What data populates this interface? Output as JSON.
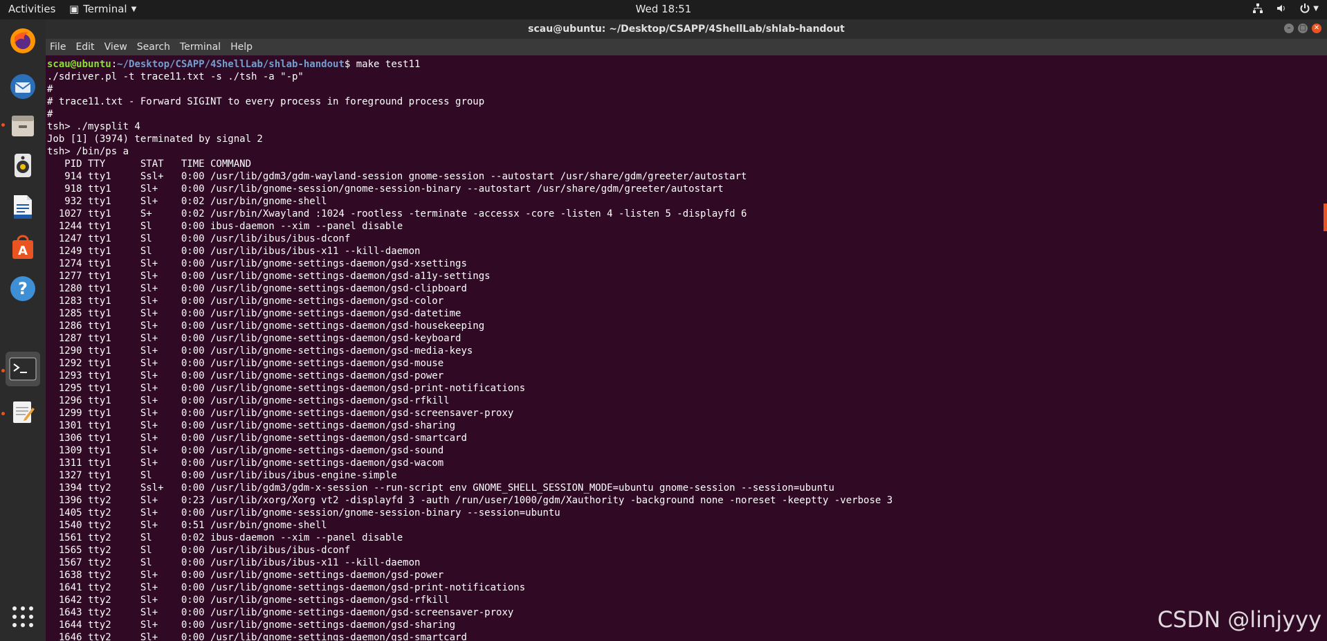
{
  "topbar": {
    "activities": "Activities",
    "app_name": "Terminal",
    "clock": "Wed 18:51",
    "tray_icons": [
      "network-icon",
      "volume-icon",
      "power-icon"
    ]
  },
  "dock": {
    "items": [
      {
        "name": "firefox-icon",
        "glyph": "🦊"
      },
      {
        "name": "thunderbird-icon",
        "glyph": "✉"
      },
      {
        "name": "files-icon",
        "glyph": "🗄"
      },
      {
        "name": "rhythmbox-icon",
        "glyph": "🔊"
      },
      {
        "name": "writer-icon",
        "glyph": "📄"
      },
      {
        "name": "software-icon",
        "glyph": "A"
      },
      {
        "name": "help-icon",
        "glyph": "?"
      },
      {
        "name": "terminal-icon",
        "glyph": ">_"
      },
      {
        "name": "text-editor-icon",
        "glyph": "✎"
      }
    ],
    "apps_grid": "show-applications-icon"
  },
  "window": {
    "title": "scau@ubuntu: ~/Desktop/CSAPP/4ShellLab/shlab-handout",
    "menu": [
      "File",
      "Edit",
      "View",
      "Search",
      "Terminal",
      "Help"
    ]
  },
  "terminal": {
    "prompt_user": "scau@ubuntu",
    "prompt_path": "~/Desktop/CSAPP/4ShellLab/shlab-handout",
    "command": "make test11",
    "lines": [
      "./sdriver.pl -t trace11.txt -s ./tsh -a \"-p\"",
      "#",
      "# trace11.txt - Forward SIGINT to every process in foreground process group",
      "#",
      "tsh> ./mysplit 4",
      "Job [1] (3974) terminated by signal 2",
      "tsh> /bin/ps a",
      "   PID TTY      STAT   TIME COMMAND",
      "   914 tty1     Ssl+   0:00 /usr/lib/gdm3/gdm-wayland-session gnome-session --autostart /usr/share/gdm/greeter/autostart",
      "   918 tty1     Sl+    0:00 /usr/lib/gnome-session/gnome-session-binary --autostart /usr/share/gdm/greeter/autostart",
      "   932 tty1     Sl+    0:02 /usr/bin/gnome-shell",
      "  1027 tty1     S+     0:02 /usr/bin/Xwayland :1024 -rootless -terminate -accessx -core -listen 4 -listen 5 -displayfd 6",
      "  1244 tty1     Sl     0:00 ibus-daemon --xim --panel disable",
      "  1247 tty1     Sl     0:00 /usr/lib/ibus/ibus-dconf",
      "  1249 tty1     Sl     0:00 /usr/lib/ibus/ibus-x11 --kill-daemon",
      "  1274 tty1     Sl+    0:00 /usr/lib/gnome-settings-daemon/gsd-xsettings",
      "  1277 tty1     Sl+    0:00 /usr/lib/gnome-settings-daemon/gsd-a11y-settings",
      "  1280 tty1     Sl+    0:00 /usr/lib/gnome-settings-daemon/gsd-clipboard",
      "  1283 tty1     Sl+    0:00 /usr/lib/gnome-settings-daemon/gsd-color",
      "  1285 tty1     Sl+    0:00 /usr/lib/gnome-settings-daemon/gsd-datetime",
      "  1286 tty1     Sl+    0:00 /usr/lib/gnome-settings-daemon/gsd-housekeeping",
      "  1287 tty1     Sl+    0:00 /usr/lib/gnome-settings-daemon/gsd-keyboard",
      "  1290 tty1     Sl+    0:00 /usr/lib/gnome-settings-daemon/gsd-media-keys",
      "  1292 tty1     Sl+    0:00 /usr/lib/gnome-settings-daemon/gsd-mouse",
      "  1293 tty1     Sl+    0:00 /usr/lib/gnome-settings-daemon/gsd-power",
      "  1295 tty1     Sl+    0:00 /usr/lib/gnome-settings-daemon/gsd-print-notifications",
      "  1296 tty1     Sl+    0:00 /usr/lib/gnome-settings-daemon/gsd-rfkill",
      "  1299 tty1     Sl+    0:00 /usr/lib/gnome-settings-daemon/gsd-screensaver-proxy",
      "  1301 tty1     Sl+    0:00 /usr/lib/gnome-settings-daemon/gsd-sharing",
      "  1306 tty1     Sl+    0:00 /usr/lib/gnome-settings-daemon/gsd-smartcard",
      "  1309 tty1     Sl+    0:00 /usr/lib/gnome-settings-daemon/gsd-sound",
      "  1311 tty1     Sl+    0:00 /usr/lib/gnome-settings-daemon/gsd-wacom",
      "  1327 tty1     Sl     0:00 /usr/lib/ibus/ibus-engine-simple",
      "  1394 tty2     Ssl+   0:00 /usr/lib/gdm3/gdm-x-session --run-script env GNOME_SHELL_SESSION_MODE=ubuntu gnome-session --session=ubuntu",
      "  1396 tty2     Sl+    0:23 /usr/lib/xorg/Xorg vt2 -displayfd 3 -auth /run/user/1000/gdm/Xauthority -background none -noreset -keeptty -verbose 3",
      "  1405 tty2     Sl+    0:00 /usr/lib/gnome-session/gnome-session-binary --session=ubuntu",
      "  1540 tty2     Sl+    0:51 /usr/bin/gnome-shell",
      "  1561 tty2     Sl     0:02 ibus-daemon --xim --panel disable",
      "  1565 tty2     Sl     0:00 /usr/lib/ibus/ibus-dconf",
      "  1567 tty2     Sl     0:00 /usr/lib/ibus/ibus-x11 --kill-daemon",
      "  1638 tty2     Sl+    0:00 /usr/lib/gnome-settings-daemon/gsd-power",
      "  1641 tty2     Sl+    0:00 /usr/lib/gnome-settings-daemon/gsd-print-notifications",
      "  1642 tty2     Sl+    0:00 /usr/lib/gnome-settings-daemon/gsd-rfkill",
      "  1643 tty2     Sl+    0:00 /usr/lib/gnome-settings-daemon/gsd-screensaver-proxy",
      "  1644 tty2     Sl+    0:00 /usr/lib/gnome-settings-daemon/gsd-sharing",
      "  1646 tty2     Sl+    0:00 /usr/lib/gnome-settings-daemon/gsd-smartcard"
    ]
  },
  "watermark": "CSDN @linjyyy",
  "colors": {
    "terminal_bg": "#300a24",
    "prompt_user": "#8ae234",
    "prompt_path": "#729fcf",
    "accent": "#e95420"
  }
}
